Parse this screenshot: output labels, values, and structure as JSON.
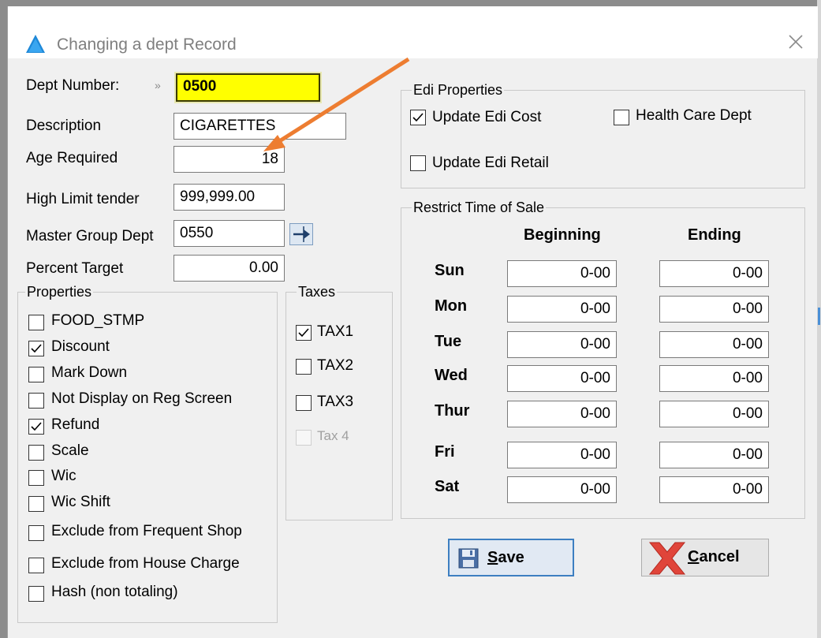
{
  "window": {
    "title": "Changing a dept Record"
  },
  "fields": {
    "dept_number_label": "Dept Number:",
    "dept_number_chevron": "»",
    "dept_number_value": "0500",
    "description_label": "Description",
    "description_value": "CIGARETTES",
    "age_label": "Age Required",
    "age_value": "18",
    "high_limit_label": "High Limit tender",
    "high_limit_value": "999,999.00",
    "master_group_label": "Master Group Dept",
    "master_group_value": "0550",
    "percent_target_label": "Percent Target",
    "percent_target_value": "0.00"
  },
  "properties": {
    "legend": "Properties",
    "items": [
      {
        "label": "FOOD_STMP",
        "checked": false
      },
      {
        "label": "Discount",
        "checked": true
      },
      {
        "label": "Mark Down",
        "checked": false
      },
      {
        "label": "Not Display on Reg Screen",
        "checked": false
      },
      {
        "label": "Refund",
        "checked": true
      },
      {
        "label": "Scale",
        "checked": false
      },
      {
        "label": "Wic",
        "checked": false
      },
      {
        "label": "Wic Shift",
        "checked": false
      },
      {
        "label": "Exclude from Frequent Shop",
        "checked": false
      },
      {
        "label": "Exclude from House Charge",
        "checked": false
      },
      {
        "label": "Hash (non totaling)",
        "checked": false
      }
    ]
  },
  "taxes": {
    "legend": "Taxes",
    "items": [
      {
        "label": "TAX1",
        "checked": true,
        "enabled": true
      },
      {
        "label": "TAX2",
        "checked": false,
        "enabled": true
      },
      {
        "label": "TAX3",
        "checked": false,
        "enabled": true
      },
      {
        "label": "Tax 4",
        "checked": false,
        "enabled": false
      }
    ]
  },
  "edi": {
    "legend": "Edi Properties",
    "update_cost": {
      "label": "Update Edi Cost",
      "checked": true
    },
    "health_care": {
      "label": "Health Care Dept",
      "checked": false
    },
    "update_retail": {
      "label": "Update Edi Retail",
      "checked": false
    }
  },
  "restrict": {
    "legend": "Restrict Time of Sale",
    "beginning_header": "Beginning",
    "ending_header": "Ending",
    "days": [
      {
        "day": "Sun",
        "begin": "0-00",
        "end": "0-00"
      },
      {
        "day": "Mon",
        "begin": "0-00",
        "end": "0-00"
      },
      {
        "day": "Tue",
        "begin": "0-00",
        "end": "0-00"
      },
      {
        "day": "Wed",
        "begin": "0-00",
        "end": "0-00"
      },
      {
        "day": "Thur",
        "begin": "0-00",
        "end": "0-00"
      },
      {
        "day": "Fri",
        "begin": "0-00",
        "end": "0-00"
      },
      {
        "day": "Sat",
        "begin": "0-00",
        "end": "0-00"
      }
    ]
  },
  "buttons": {
    "save_mnemonic": "S",
    "save_rest": "ave",
    "cancel_mnemonic": "C",
    "cancel_rest": "ancel"
  },
  "colors": {
    "field_highlight": "#ffff00",
    "annotation_arrow": "#ed7d31",
    "primary_border": "#3d7fc1"
  },
  "icons": {
    "app": "blue-triangle-icon",
    "close": "close-icon",
    "lookup": "arrow-right-icon",
    "save": "floppy-disk-icon",
    "cancel": "red-x-icon"
  }
}
